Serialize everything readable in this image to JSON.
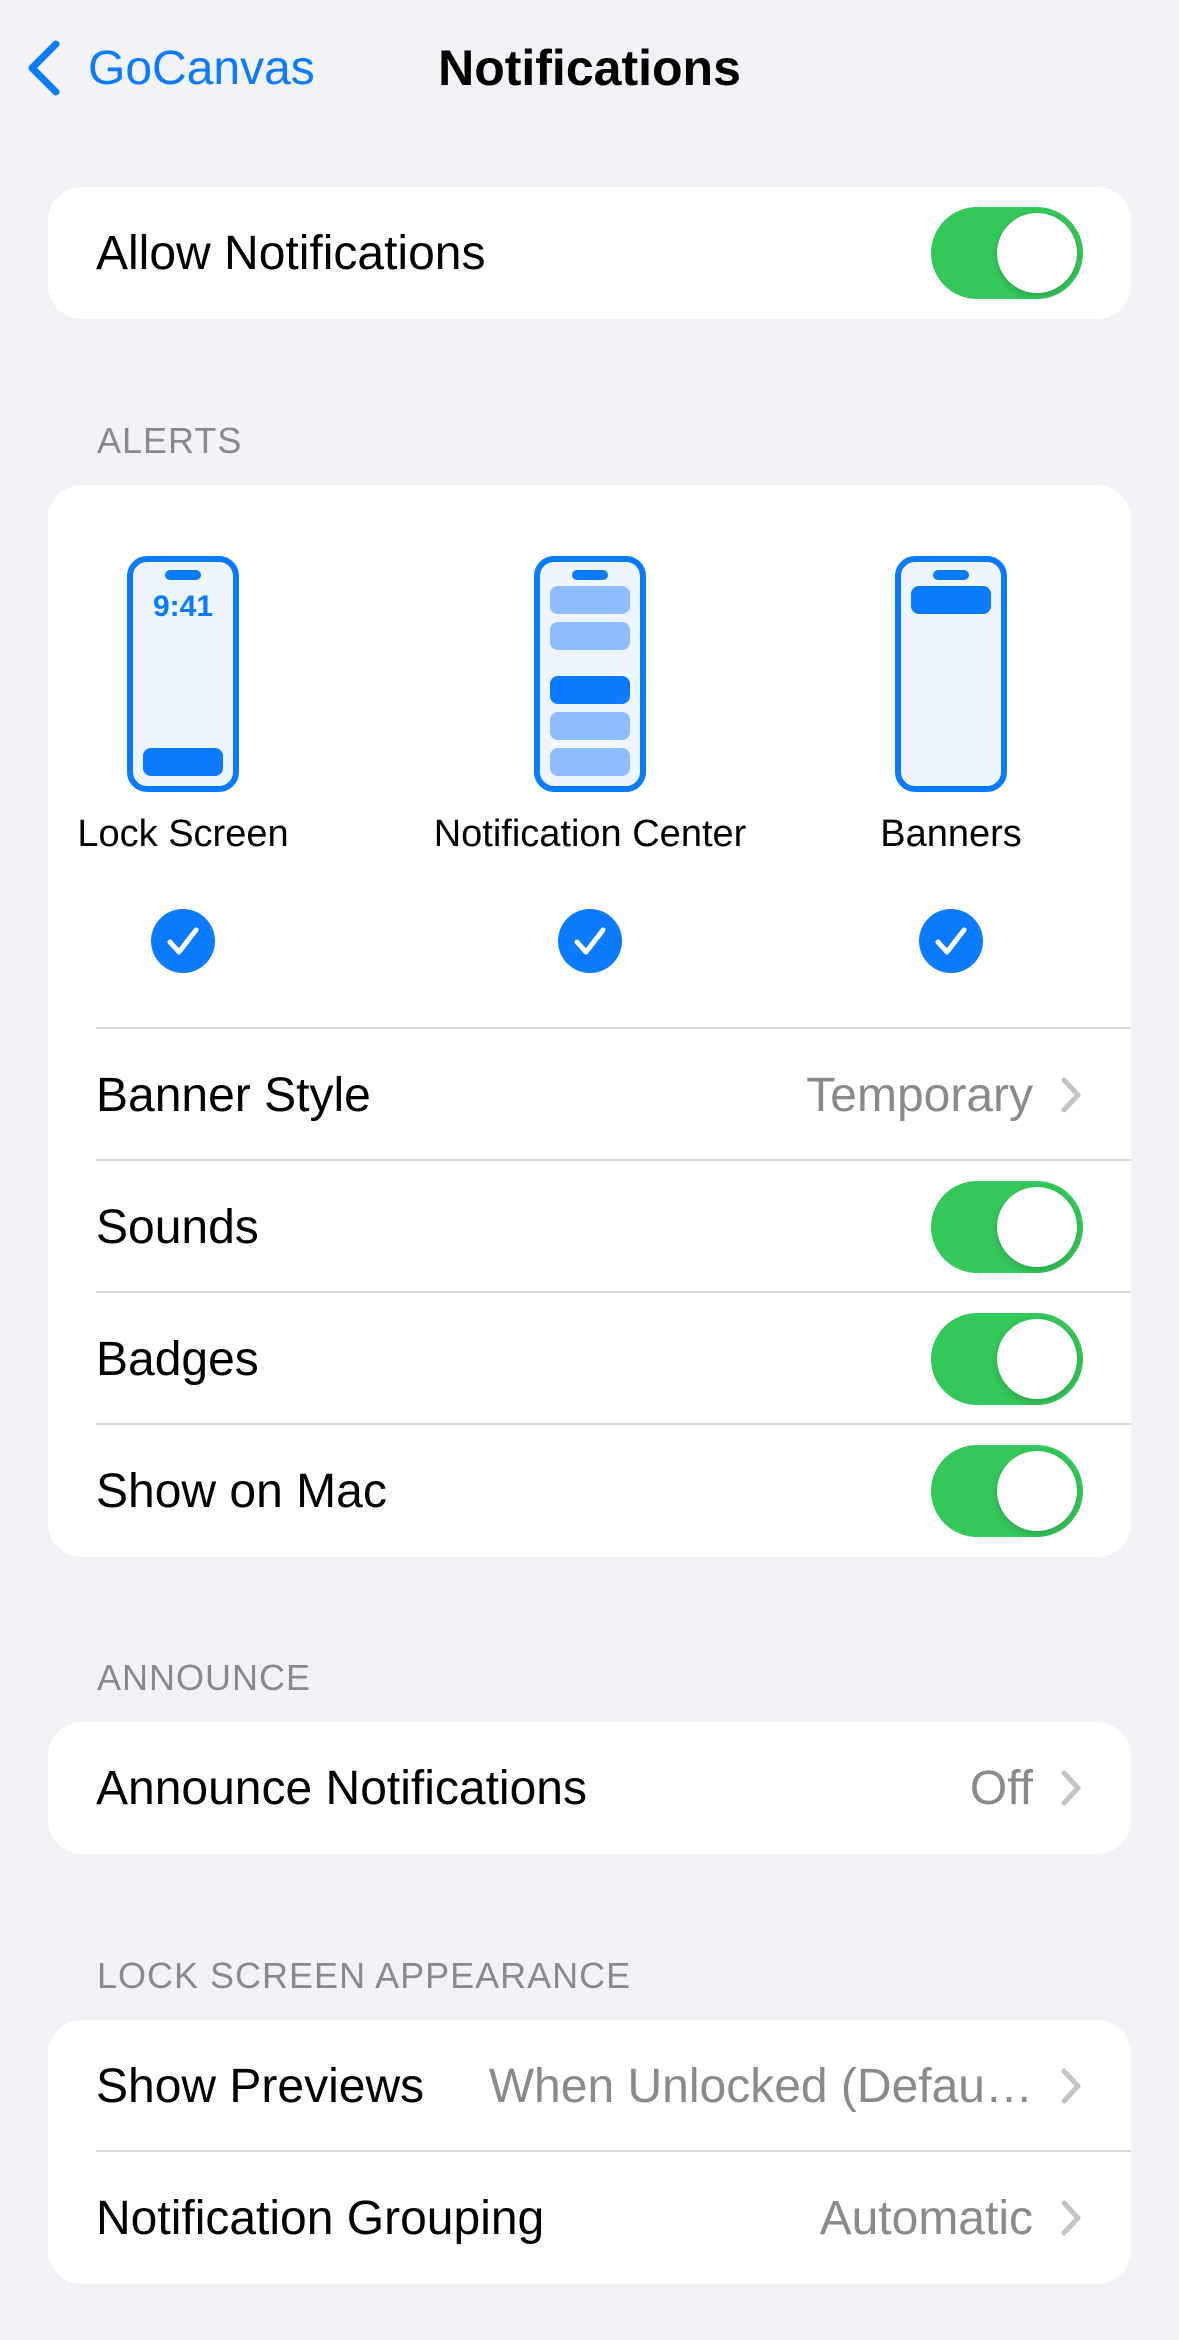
{
  "nav": {
    "back_label": "GoCanvas",
    "title": "Notifications"
  },
  "allow": {
    "label": "Allow Notifications",
    "on": true
  },
  "alerts": {
    "header": "ALERTS",
    "styles": [
      {
        "label": "Lock Screen",
        "icon": "lock-screen-icon",
        "time": "9:41",
        "checked": true
      },
      {
        "label": "Notification Center",
        "icon": "notification-center-icon",
        "checked": true
      },
      {
        "label": "Banners",
        "icon": "banners-icon",
        "checked": true
      }
    ],
    "banner_style": {
      "label": "Banner Style",
      "value": "Temporary"
    },
    "sounds": {
      "label": "Sounds",
      "on": true
    },
    "badges": {
      "label": "Badges",
      "on": true
    },
    "show_on_mac": {
      "label": "Show on Mac",
      "on": true
    }
  },
  "announce": {
    "header": "ANNOUNCE",
    "announce_notifications": {
      "label": "Announce Notifications",
      "value": "Off"
    }
  },
  "lock_screen_appearance": {
    "header": "LOCK SCREEN APPEARANCE",
    "show_previews": {
      "label": "Show Previews",
      "value": "When Unlocked (Defau…"
    },
    "notification_grouping": {
      "label": "Notification Grouping",
      "value": "Automatic"
    }
  },
  "colors": {
    "accent": "#0A7AFF",
    "toggle_on": "#34C759",
    "background": "#F2F2F7",
    "secondary_text": "#8A8A8E"
  }
}
